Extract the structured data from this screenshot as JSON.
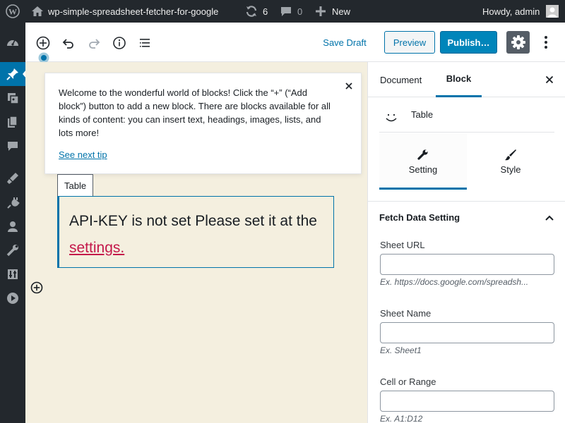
{
  "adminbar": {
    "site_name": "wp-simple-spreadsheet-fetcher-for-google",
    "updates_count": "6",
    "comments_count": "0",
    "new_label": "New",
    "howdy": "Howdy, admin"
  },
  "toolbar": {
    "save_draft": "Save Draft",
    "preview": "Preview",
    "publish": "Publish…"
  },
  "tip": {
    "text": "Welcome to the wonderful world of blocks! Click the “+” (“Add block”) button to add a new block. There are blocks available for all kinds of content: you can insert text, headings, images, lists, and lots more!",
    "next_link": "See next tip"
  },
  "block": {
    "label": "Table",
    "message": "API-KEY is not set Please set it at the",
    "link": "settings."
  },
  "inspector": {
    "tabs": [
      "Document",
      "Block"
    ],
    "block_name": "Table",
    "subtabs": [
      "Setting",
      "Style"
    ],
    "panel_title": "Fetch Data Setting",
    "fields": [
      {
        "label": "Sheet URL",
        "help": "Ex. https://docs.google.com/spreadsh..."
      },
      {
        "label": "Sheet Name",
        "help": "Ex. Sheet1"
      },
      {
        "label": "Cell or Range",
        "help": "Ex. A1:D12"
      }
    ]
  },
  "colors": {
    "admin_bg": "#23282d",
    "accent": "#0073aa",
    "canvas_bg": "#f4efdf",
    "link_red": "#c4184a"
  }
}
